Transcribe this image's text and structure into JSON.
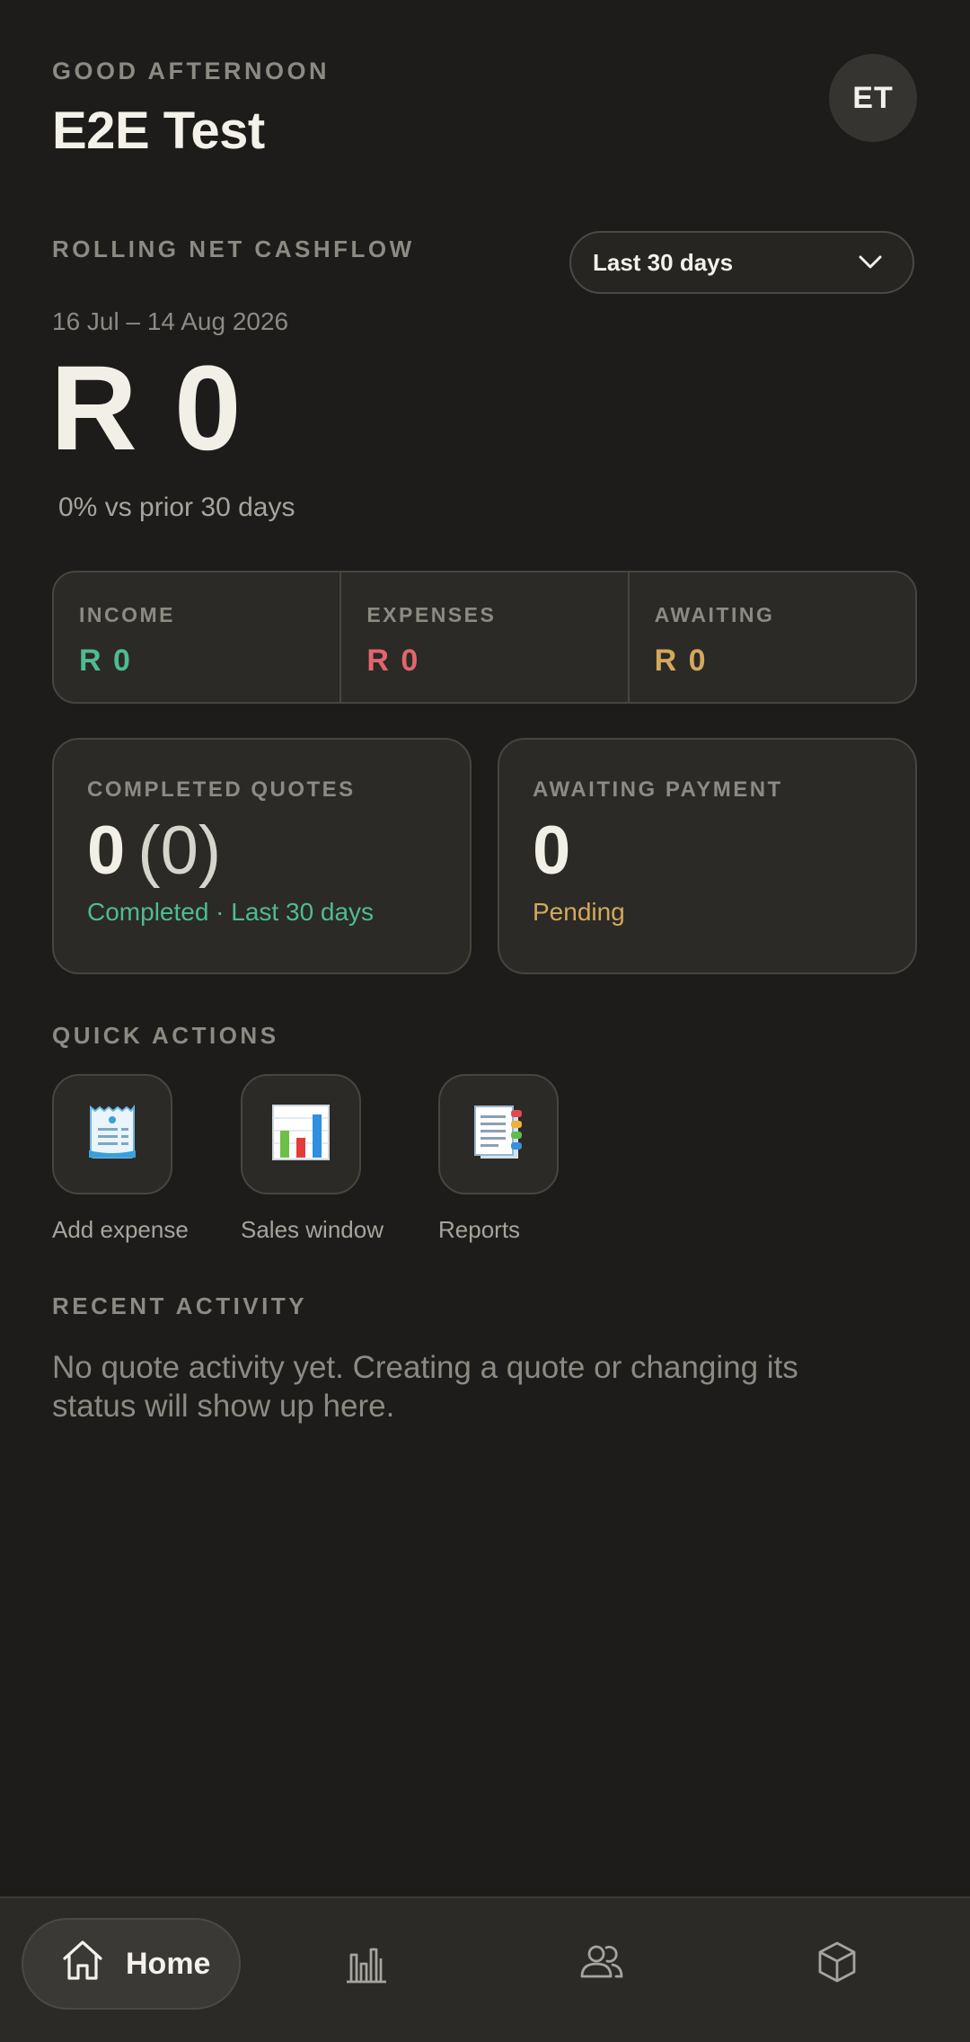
{
  "header": {
    "greeting": "GOOD AFTERNOON",
    "user_name": "E2E Test",
    "avatar_initials": "ET"
  },
  "cashflow": {
    "title": "ROLLING NET CASHFLOW",
    "period_selected": "Last 30 days",
    "date_range": "16 Jul – 14 Aug 2026",
    "net_amount": "R 0",
    "comparison": "0% vs prior 30 days"
  },
  "summary": {
    "income_label": "INCOME",
    "income_value": "R 0",
    "expenses_label": "EXPENSES",
    "expenses_value": "R 0",
    "awaiting_label": "AWAITING",
    "awaiting_value": "R 0"
  },
  "completed_quotes": {
    "label": "COMPLETED QUOTES",
    "count": "0",
    "paren_count": "(0)",
    "subtitle": "Completed · Last 30 days"
  },
  "awaiting_payment": {
    "label": "AWAITING PAYMENT",
    "count": "0",
    "subtitle": "Pending"
  },
  "quick_actions": {
    "title": "QUICK ACTIONS",
    "items": [
      {
        "label": "Add expense",
        "icon": "receipt-icon"
      },
      {
        "label": "Sales window",
        "icon": "bar-chart-icon"
      },
      {
        "label": "Reports",
        "icon": "document-icon"
      }
    ]
  },
  "recent_activity": {
    "title": "RECENT ACTIVITY",
    "empty_message": "No quote activity yet. Creating a quote or changing its status will show up here."
  },
  "nav": {
    "home_label": "Home",
    "icons": [
      "home-icon",
      "stats-icon",
      "customers-icon",
      "products-icon"
    ]
  },
  "colors": {
    "background": "#1d1c1a",
    "income": "#4fbb93",
    "expenses": "#e2666c",
    "awaiting": "#d4a85d"
  }
}
